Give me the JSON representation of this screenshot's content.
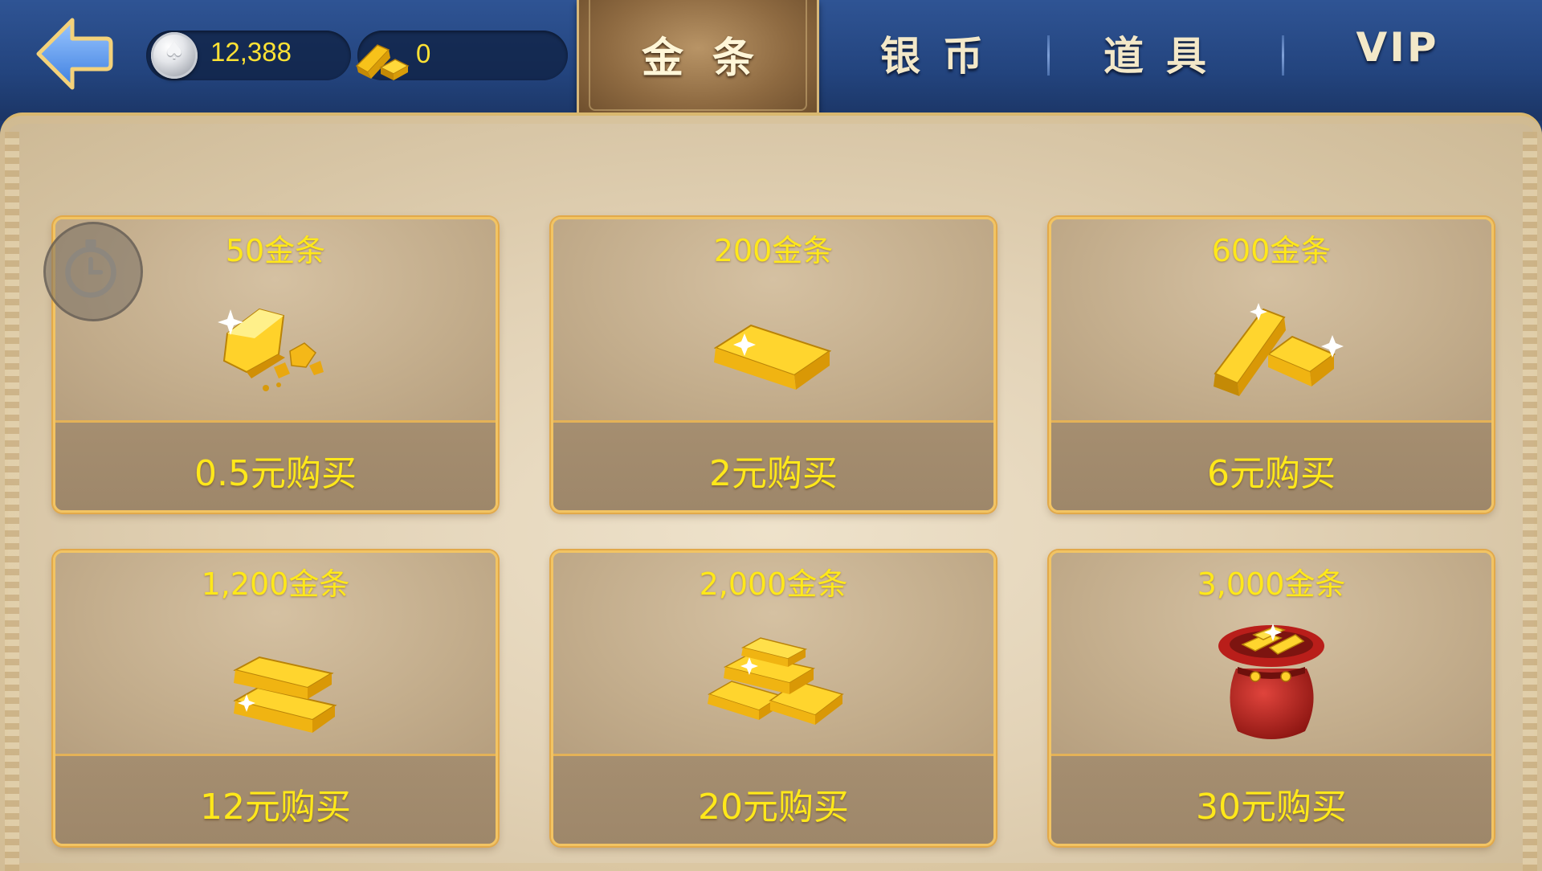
{
  "header": {
    "silver_balance": "12,388",
    "gold_balance": "0",
    "tabs": [
      {
        "label": "金条",
        "active": true
      },
      {
        "label": "银币",
        "active": false
      },
      {
        "label": "道具",
        "active": false
      },
      {
        "label": "VIP",
        "active": false
      }
    ]
  },
  "products": [
    {
      "amount": "50金条",
      "price": "0.5元购买",
      "icon": "gold-nugget-icon"
    },
    {
      "amount": "200金条",
      "price": "2元购买",
      "icon": "gold-bar-icon"
    },
    {
      "amount": "600金条",
      "price": "6元购买",
      "icon": "two-gold-bars-icon"
    },
    {
      "amount": "1,200金条",
      "price": "12元购买",
      "icon": "stacked-gold-bars-icon"
    },
    {
      "amount": "2,000金条",
      "price": "20元购买",
      "icon": "gold-bar-pile-icon"
    },
    {
      "amount": "3,000金条",
      "price": "30元购买",
      "icon": "gold-bag-icon"
    }
  ],
  "colors": {
    "header_blue": "#23447e",
    "price_yellow": "#ffe81a",
    "card_border": "#f2c463"
  }
}
